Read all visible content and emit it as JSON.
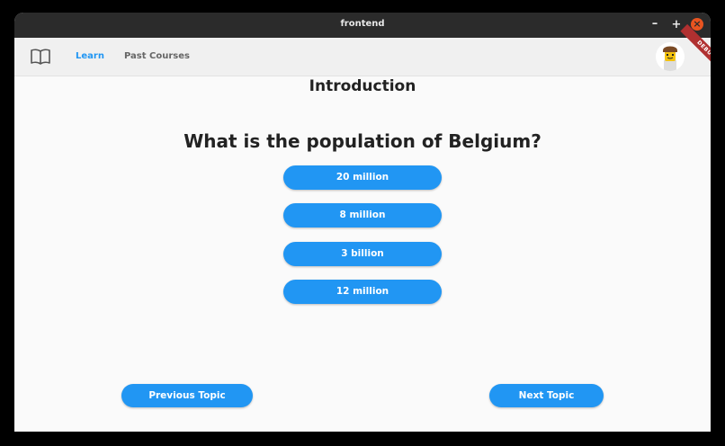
{
  "window": {
    "title": "frontend",
    "minimize": "–",
    "maximize": "+",
    "close": "×"
  },
  "appbar": {
    "logo_icon": "book-icon",
    "nav": [
      {
        "label": "Learn",
        "active": true
      },
      {
        "label": "Past Courses",
        "active": false
      }
    ],
    "avatar_icon": "avatar-icon",
    "debug_banner": "DEBUG"
  },
  "main": {
    "heading": "Introduction",
    "question": "What is the population of Belgium?",
    "answers": [
      "20 million",
      "8 million",
      "3 billion",
      "12 million"
    ],
    "previous_label": "Previous Topic",
    "next_label": "Next Topic"
  },
  "colors": {
    "accent": "#2196f3",
    "titlebar": "#2b2b2b",
    "close": "#e95420"
  }
}
